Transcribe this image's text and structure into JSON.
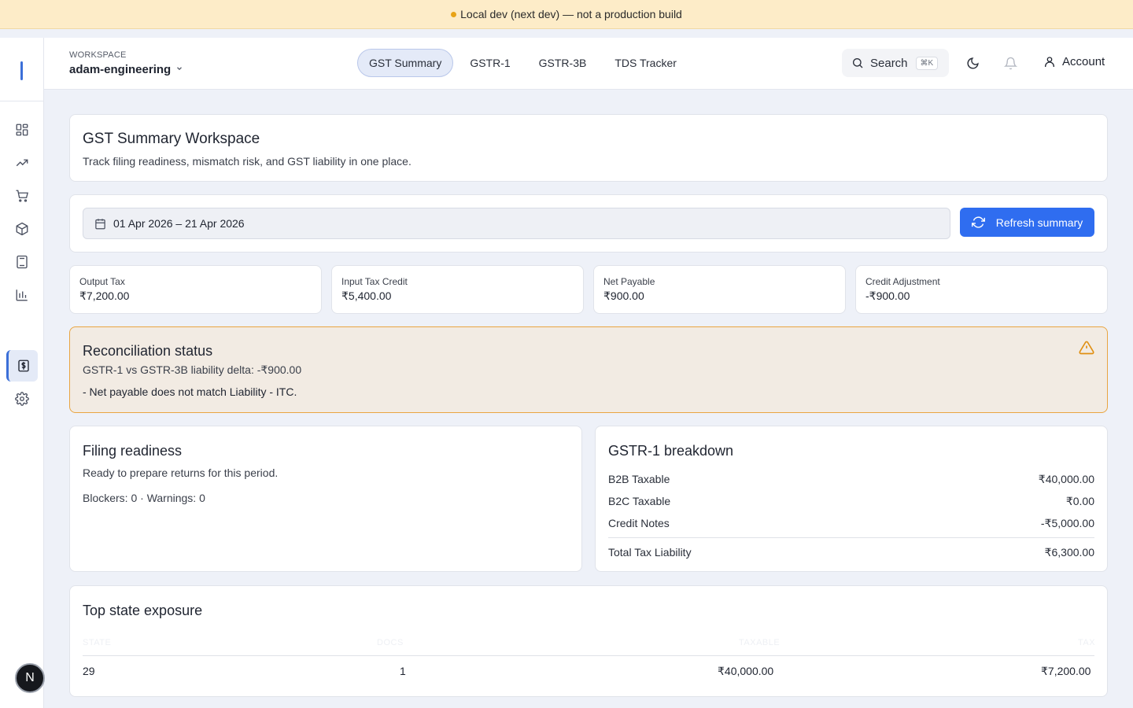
{
  "banner": {
    "text": "Local dev (next dev) — not a production build"
  },
  "sidebar": {
    "items": [
      {
        "icon": "grid-icon"
      },
      {
        "icon": "trending-up-icon"
      },
      {
        "icon": "cart-icon"
      },
      {
        "icon": "package-icon"
      },
      {
        "icon": "calculator-icon"
      },
      {
        "icon": "bar-chart-icon"
      },
      {
        "icon": "receipt-dollar-icon",
        "active": true
      },
      {
        "icon": "gear-icon"
      }
    ],
    "avatar_letter": "N"
  },
  "header": {
    "workspace_label": "WORKSPACE",
    "workspace_name": "adam-engineering",
    "tabs": [
      {
        "label": "GST Summary",
        "active": true
      },
      {
        "label": "GSTR-1"
      },
      {
        "label": "GSTR-3B"
      },
      {
        "label": "TDS Tracker"
      }
    ],
    "search_label": "Search",
    "search_shortcut": "⌘K",
    "account_label": "Account"
  },
  "intro": {
    "title": "GST Summary Workspace",
    "subtitle": "Track filing readiness, mismatch risk, and GST liability in one place."
  },
  "filters": {
    "date_range": "01 Apr 2026 – 21 Apr 2026",
    "refresh_label": "Refresh summary"
  },
  "metrics": [
    {
      "label": "Output Tax",
      "value": "₹7,200.00"
    },
    {
      "label": "Input Tax Credit",
      "value": "₹5,400.00"
    },
    {
      "label": "Net Payable",
      "value": "₹900.00"
    },
    {
      "label": "Credit Adjustment",
      "value": "-₹900.00"
    }
  ],
  "reconciliation": {
    "title": "Reconciliation status",
    "delta_text": "GSTR-1 vs GSTR-3B liability delta: -₹900.00",
    "issue": "- Net payable does not match Liability - ITC."
  },
  "readiness": {
    "title": "Filing readiness",
    "status": "Ready to prepare returns for this period.",
    "counts": "Blockers: 0 · Warnings: 0"
  },
  "gstr1": {
    "title": "GSTR-1 breakdown",
    "rows": [
      {
        "label": "B2B Taxable",
        "value": "₹40,000.00"
      },
      {
        "label": "B2C Taxable",
        "value": "₹0.00"
      },
      {
        "label": "Credit Notes",
        "value": "-₹5,000.00"
      }
    ],
    "total_label": "Total Tax Liability",
    "total_value": "₹6,300.00"
  },
  "states": {
    "title": "Top state exposure",
    "columns": [
      "STATE",
      "DOCS",
      "TAXABLE",
      "TAX"
    ],
    "rows": [
      {
        "state": "29",
        "docs": "1",
        "taxable": "₹40,000.00",
        "tax": "₹7,200.00"
      }
    ]
  },
  "colors": {
    "accent": "#2f6df0",
    "banner_bg": "#fdecc8",
    "warning_border": "#e9a541",
    "warning_bg": "#f2ebe3"
  }
}
